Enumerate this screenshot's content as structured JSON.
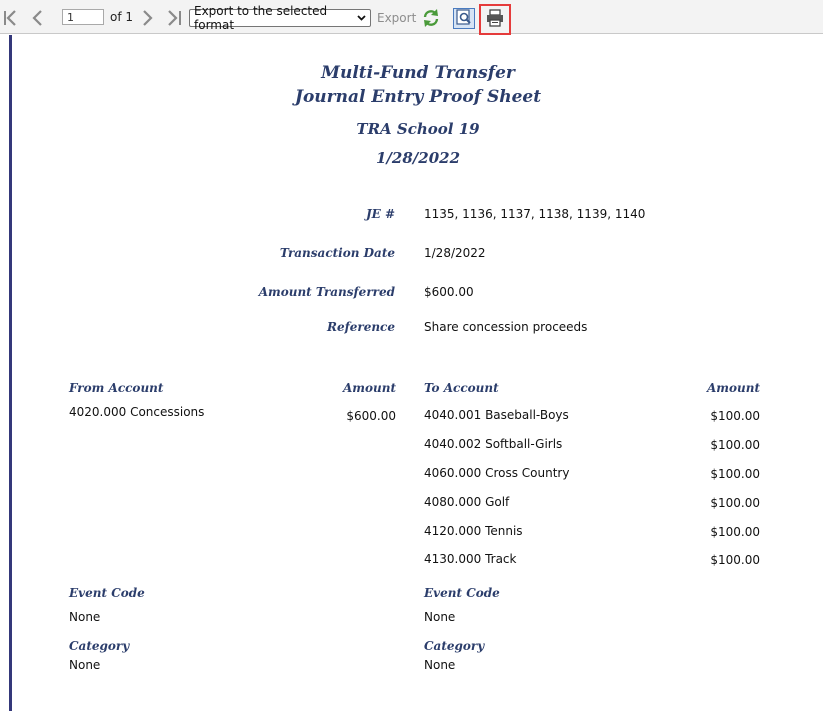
{
  "toolbar": {
    "page_value": "1",
    "page_of": "of 1",
    "export_format": "Export to the selected format",
    "export_label": "Export"
  },
  "report": {
    "title_line1": "Multi-Fund Transfer",
    "title_line2": "Journal Entry Proof Sheet",
    "school": "TRA School 19",
    "date": "1/28/2022",
    "fields": {
      "je_label": "JE #",
      "je_value": "1135, 1136, 1137, 1138, 1139, 1140",
      "tdate_label": "Transaction Date",
      "tdate_value": "1/28/2022",
      "amount_label": "Amount Transferred",
      "amount_value": "$600.00",
      "reference_label": "Reference",
      "reference_value": "Share concession proceeds"
    },
    "from": {
      "header": "From Account",
      "amount_header": "Amount",
      "account": "4020.000 Concessions",
      "amount": "$600.00",
      "event_code_label": "Event Code",
      "event_code_value": "None",
      "category_label": "Category",
      "category_value": "None"
    },
    "to": {
      "header": "To Account",
      "amount_header": "Amount",
      "rows": [
        {
          "account": "4040.001 Baseball-Boys",
          "amount": "$100.00"
        },
        {
          "account": "4040.002 Softball-Girls",
          "amount": "$100.00"
        },
        {
          "account": "4060.000 Cross Country",
          "amount": "$100.00"
        },
        {
          "account": "4080.000 Golf",
          "amount": "$100.00"
        },
        {
          "account": "4120.000 Tennis",
          "amount": "$100.00"
        },
        {
          "account": "4130.000 Track",
          "amount": "$100.00"
        }
      ],
      "event_code_label": "Event Code",
      "event_code_value": "None",
      "category_label": "Category",
      "category_value": "None"
    }
  },
  "colors": {
    "report_heading": "#2b3d6b",
    "highlight_box": "#e53b3b",
    "left_rule": "#34387a"
  }
}
